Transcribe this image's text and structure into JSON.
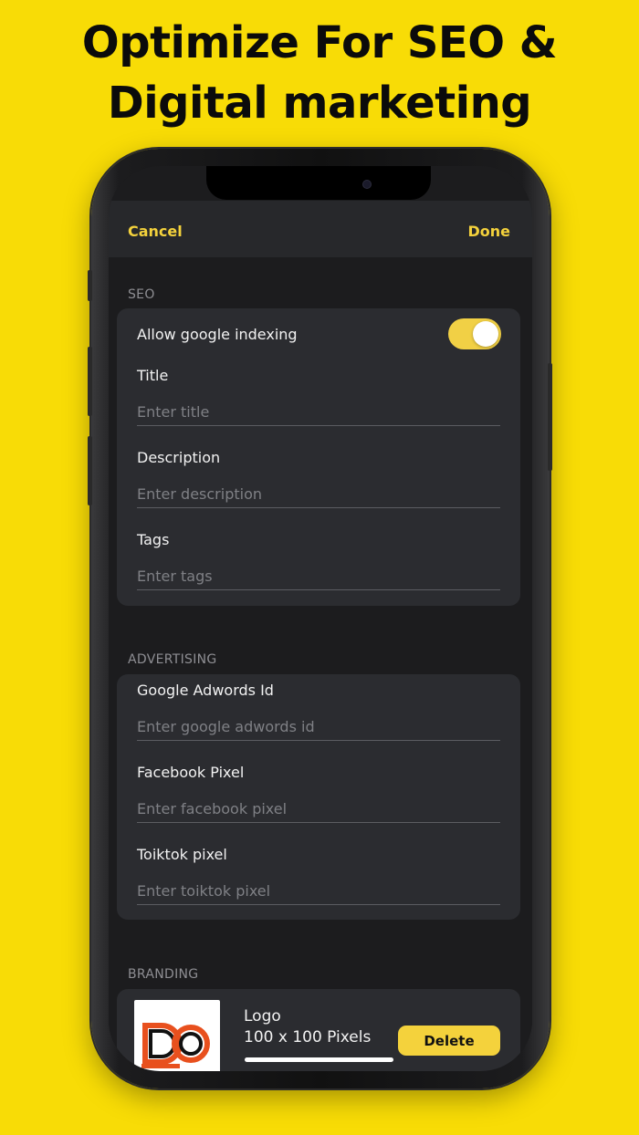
{
  "headline": {
    "line1": "Optimize For SEO &",
    "line2": "Digital marketing"
  },
  "navbar": {
    "cancel_label": "Cancel",
    "done_label": "Done"
  },
  "seo": {
    "header": "SEO",
    "google_indexing_label": "Allow google indexing",
    "google_indexing_on": true,
    "title_label": "Title",
    "title_placeholder": "Enter title",
    "description_label": "Description",
    "description_placeholder": "Enter description",
    "tags_label": "Tags",
    "tags_placeholder": "Enter tags"
  },
  "advertising": {
    "header": "ADVERTISING",
    "adwords_label": "Google Adwords Id",
    "adwords_placeholder": "Enter google adwords id",
    "facebook_label": "Facebook Pixel",
    "facebook_placeholder": "Enter facebook pixel",
    "tiktok_label": "Toiktok pixel",
    "tiktok_placeholder": "Enter toiktok pixel"
  },
  "branding": {
    "header": "BRANDING",
    "logo_title": "Logo",
    "logo_size": "100 x 100 Pixels",
    "delete_label": "Delete"
  },
  "colors": {
    "background": "#f8dc06",
    "accent": "#f4d23c",
    "screen": "#1c1c1e",
    "group": "#2b2c30"
  }
}
